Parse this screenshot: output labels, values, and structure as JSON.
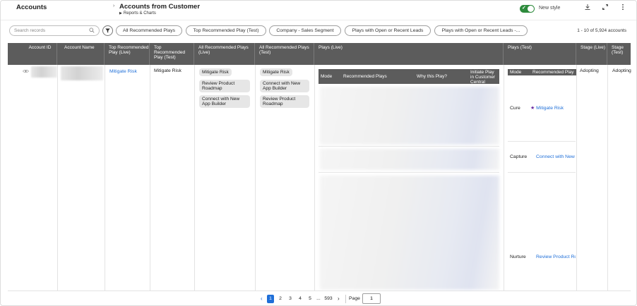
{
  "header": {
    "title": "Accounts",
    "breadcrumb_title": "Accounts from Customer",
    "breadcrumb_sub": "Reports & Charts",
    "new_style_label": "New style"
  },
  "icons": {
    "download": "download-icon",
    "expand": "expand-icon",
    "more": "more-vertical-icon",
    "search": "search-icon",
    "filter": "filter-icon",
    "eye": "eye-icon",
    "star": "star-icon"
  },
  "filters": {
    "search_placeholder": "Search records",
    "chips": [
      "All Recommended Plays",
      "Top Recommended Play (Test)",
      "Company - Sales Segment",
      "Plays with Open or Recent Leads",
      "Plays with Open or Recent Leads -..."
    ],
    "count": "1 - 10 of 5,924 accounts"
  },
  "table": {
    "columns": [
      "Account ID",
      "Account Name",
      "Top Recommended Play (Live)",
      "Top Recommended Play (Test)",
      "All Recommended Plays (Live)",
      "All Recommended Plays (Test)",
      "Plays (Live)",
      "Plays (Test)",
      "Stage (Live)",
      "Stage (Test)"
    ],
    "row": {
      "top_live": "Mitigate Risk",
      "top_test": "Mitigate Risk",
      "all_live": [
        "Mitigate Risk",
        "Review Product Roadmap",
        "Connect with New App Builder"
      ],
      "all_test": [
        "Mitigate Risk",
        "Connect with New App Builder",
        "Review Product Roadmap"
      ],
      "plays_live_headers": [
        "Mode",
        "Recommended Plays",
        "Why this Play?",
        "Initiate Play in Customer Central"
      ],
      "plays_test_headers": [
        "Mode",
        "Recommended Play"
      ],
      "plays_test_rows": [
        {
          "mode": "Cure",
          "play": "Mitigate Risk"
        },
        {
          "mode": "Capture",
          "play": "Connect with New"
        },
        {
          "mode": "Nurture",
          "play": "Review Product Ro"
        }
      ],
      "stage_live": "Adopting",
      "stage_test": "Adopting"
    }
  },
  "pagination": {
    "pages": [
      "1",
      "2",
      "3",
      "4",
      "5",
      "...",
      "593"
    ],
    "current": "1",
    "page_label": "Page",
    "page_value": "1"
  },
  "colors": {
    "header_bg": "#5c5c5c",
    "link": "#1f6fd8",
    "toggle": "#2e8b3d",
    "star": "#6a2aa0"
  }
}
